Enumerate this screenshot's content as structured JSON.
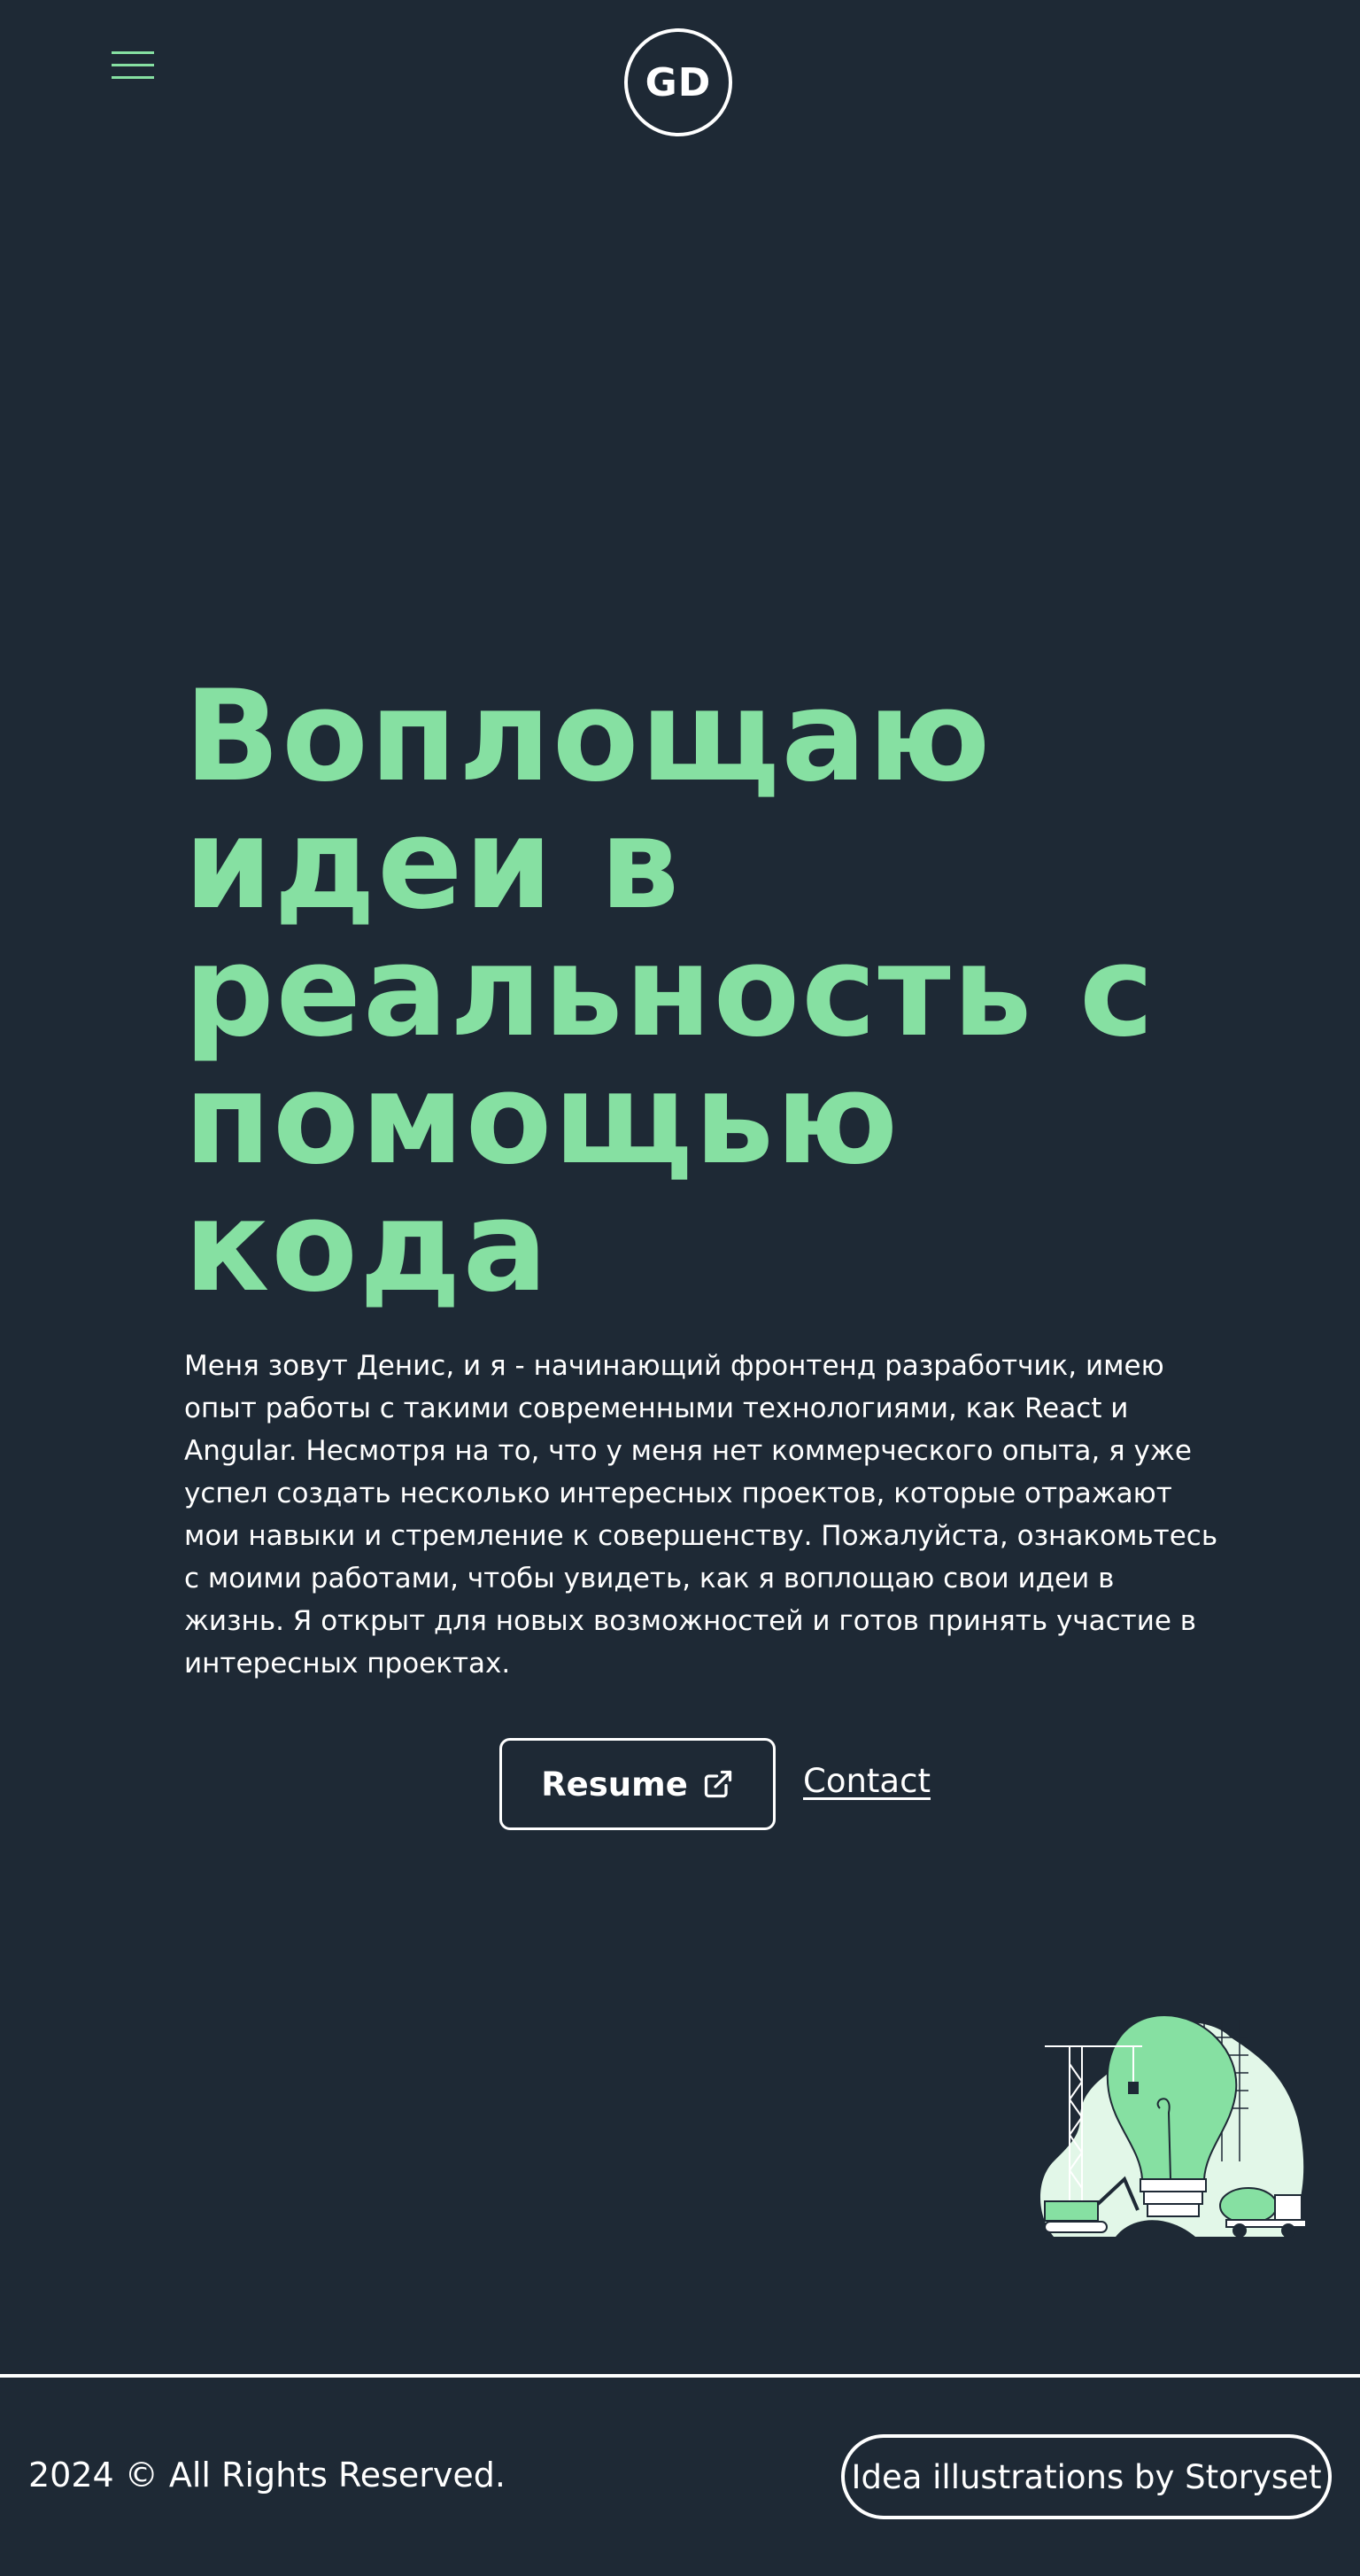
{
  "header": {
    "menu_icon": "hamburger-menu-icon",
    "logo_text": "GD"
  },
  "hero": {
    "title_lines": [
      "Воплощаю",
      "идеи в",
      "реальность с",
      "помощью",
      "кода"
    ],
    "intro_lines": [
      "Меня зовут Денис, и я - начинающий фронтенд разработчик, имею",
      "опыт работы с такими современными технологиями, как React и",
      "Angular. Несмотря на то, что у меня нет коммерческого опыта, я уже",
      "успел создать несколько интересных проектов, которые отражают",
      "мои навыки и стремление к совершенству. Пожалуйста, ознакомьтесь",
      "с моими работами, чтобы увидеть, как я воплощаю свои идеи в",
      "жизнь. Я открыт для новых возможностей и готов принять участие в",
      "интересных проектах."
    ],
    "resume_label": "Resume",
    "resume_icon": "external-link-icon",
    "contact_label": "Contact",
    "illustration": "idea-lightbulb-construction-illustration"
  },
  "footer": {
    "copyright": "2024 © All Rights Reserved.",
    "credit": "Idea illustrations by Storyset"
  },
  "colors": {
    "background": "#1e2935",
    "accent": "#86e0a2",
    "accent_light": "#e2f7e8",
    "text": "#ffffff"
  }
}
